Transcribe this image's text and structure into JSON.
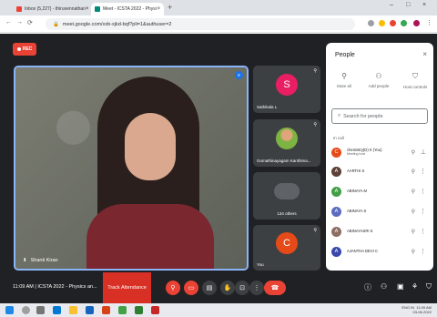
{
  "browser": {
    "tabs": [
      {
        "label": "Inbox (5,227) - thiruvennathan",
        "favicon_color": "#ea4335"
      },
      {
        "label": "Meet - ICSTA 2022 - Physi",
        "favicon_color": "#00897b"
      }
    ],
    "new_tab_glyph": "+",
    "url": "meet.google.com/xxb-xjkd-bqf?pli=1&authuser=2"
  },
  "meet": {
    "rec_label": "REC",
    "main_speaker": {
      "name": "Shanti Kiran"
    },
    "tiles": [
      {
        "initial": "S",
        "name": "Sathikala L",
        "color": "#e91e63"
      },
      {
        "initial": "",
        "name": "Gomathinayagam Kanthima...",
        "color": "#7cb342"
      },
      {
        "initial": "",
        "name": "134 others",
        "color": "#5f6368"
      },
      {
        "initial": "C",
        "name": "You",
        "color": "#e64a19"
      }
    ],
    "people_panel": {
      "title": "People",
      "actions": [
        {
          "label": "Mute all",
          "icon": "mic-off-icon"
        },
        {
          "label": "Add people",
          "icon": "add-person-icon"
        },
        {
          "label": "Host controls",
          "icon": "shield-icon"
        }
      ],
      "search_placeholder": "Search for people",
      "section_label": "In call",
      "participants": [
        {
          "initial": "C",
          "name": "chemistry(D) rt (You)",
          "sub": "Meeting host",
          "color": "#e64a19"
        },
        {
          "initial": "A",
          "name": "AARTHI S",
          "sub": "",
          "color": "#5d4037"
        },
        {
          "initial": "A",
          "name": "ABINAYA M",
          "sub": "",
          "color": "#43a047"
        },
        {
          "initial": "A",
          "name": "ABINAYA S",
          "sub": "",
          "color": "#5c6bc0"
        },
        {
          "initial": "A",
          "name": "ABINAYASRI S",
          "sub": "",
          "color": "#8d6e63"
        },
        {
          "initial": "A",
          "name": "AJANTHA DEVI C",
          "sub": "",
          "color": "#3949ab"
        }
      ]
    },
    "bottom": {
      "time": "11:09 AM",
      "separator": "|",
      "meeting_title": "ICSTA 2022 - Physics an...",
      "track_label": "Track Attendance"
    }
  },
  "taskbar": {
    "lang": "ENG IN",
    "clock_time": "11:09 AM",
    "clock_date": "03-06-2022"
  }
}
